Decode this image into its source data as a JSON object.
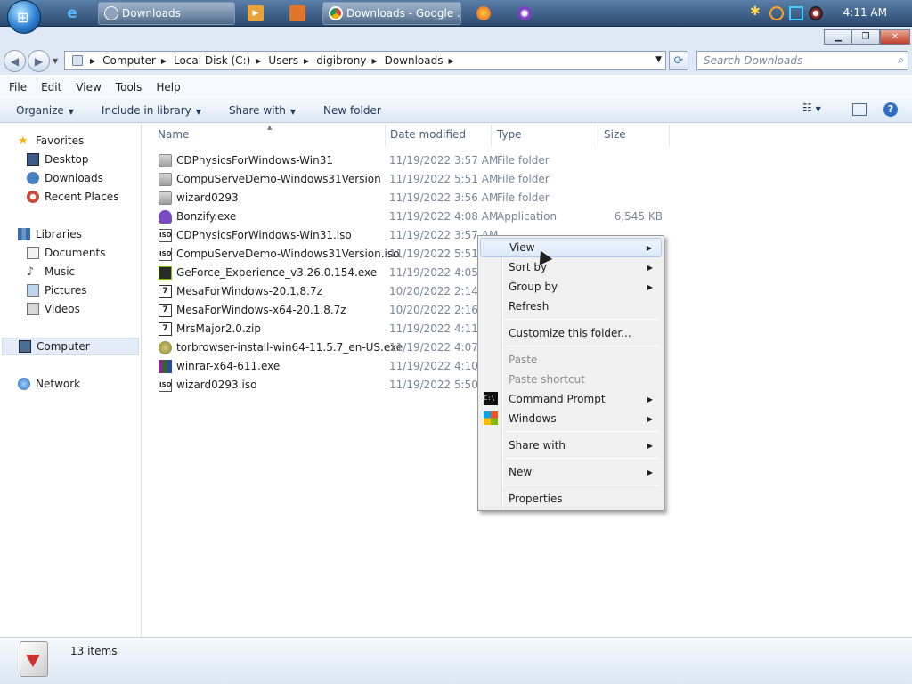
{
  "taskbar": {
    "buttons": [
      {
        "label": "Downloads"
      },
      {
        "label": "Downloads - Google ..."
      }
    ],
    "clock": "4:11 AM"
  },
  "address": {
    "crumbs": [
      "Computer",
      "Local Disk (C:)",
      "Users",
      "digibrony",
      "Downloads"
    ]
  },
  "search": {
    "placeholder": "Search Downloads"
  },
  "menubar": {
    "items": [
      "File",
      "Edit",
      "View",
      "Tools",
      "Help"
    ]
  },
  "commandbar": {
    "items": [
      "Organize",
      "Include in library",
      "Share with",
      "New folder"
    ]
  },
  "nav": {
    "favorites": "Favorites",
    "desktop": "Desktop",
    "downloads": "Downloads",
    "recent": "Recent Places",
    "libraries": "Libraries",
    "documents": "Documents",
    "music": "Music",
    "pictures": "Pictures",
    "videos": "Videos",
    "computer": "Computer",
    "network": "Network"
  },
  "columns": {
    "name": "Name",
    "date": "Date modified",
    "type": "Type",
    "size": "Size"
  },
  "files": [
    {
      "name": "CDPhysicsForWindows-Win31",
      "date": "11/19/2022 3:57 AM",
      "type": "File folder",
      "size": ""
    },
    {
      "name": "CompuServeDemo-Windows31Version",
      "date": "11/19/2022 5:51 AM",
      "type": "File folder",
      "size": ""
    },
    {
      "name": "wizard0293",
      "date": "11/19/2022 3:56 AM",
      "type": "File folder",
      "size": ""
    },
    {
      "name": "Bonzify.exe",
      "date": "11/19/2022 4:08 AM",
      "type": "Application",
      "size": "6,545 KB"
    },
    {
      "name": "CDPhysicsForWindows-Win31.iso",
      "date": "11/19/2022 3:57 AM",
      "type": "",
      "size": ""
    },
    {
      "name": "CompuServeDemo-Windows31Version.iso",
      "date": "11/19/2022 5:51 AM",
      "type": "",
      "size": ""
    },
    {
      "name": "GeForce_Experience_v3.26.0.154.exe",
      "date": "11/19/2022 4:05 AM",
      "type": "",
      "size": ""
    },
    {
      "name": "MesaForWindows-20.1.8.7z",
      "date": "10/20/2022 2:14 AM",
      "type": "",
      "size": ""
    },
    {
      "name": "MesaForWindows-x64-20.1.8.7z",
      "date": "10/20/2022 2:16 AM",
      "type": "",
      "size": ""
    },
    {
      "name": "MrsMajor2.0.zip",
      "date": "11/19/2022 4:11 AM",
      "type": "",
      "size": ""
    },
    {
      "name": "torbrowser-install-win64-11.5.7_en-US.exe",
      "date": "11/19/2022 4:07 AM",
      "type": "",
      "size": ""
    },
    {
      "name": "winrar-x64-611.exe",
      "date": "11/19/2022 4:10 AM",
      "type": "",
      "size": ""
    },
    {
      "name": "wizard0293.iso",
      "date": "11/19/2022 5:50 AM",
      "type": "",
      "size": ""
    }
  ],
  "context_menu": {
    "view": "View",
    "sort_by": "Sort by",
    "group_by": "Group by",
    "refresh": "Refresh",
    "customize": "Customize this folder...",
    "paste": "Paste",
    "paste_shortcut": "Paste shortcut",
    "command_prompt": "Command Prompt",
    "windows": "Windows",
    "share_with": "Share with",
    "new": "New",
    "properties": "Properties"
  },
  "status": {
    "count": "13 items"
  }
}
